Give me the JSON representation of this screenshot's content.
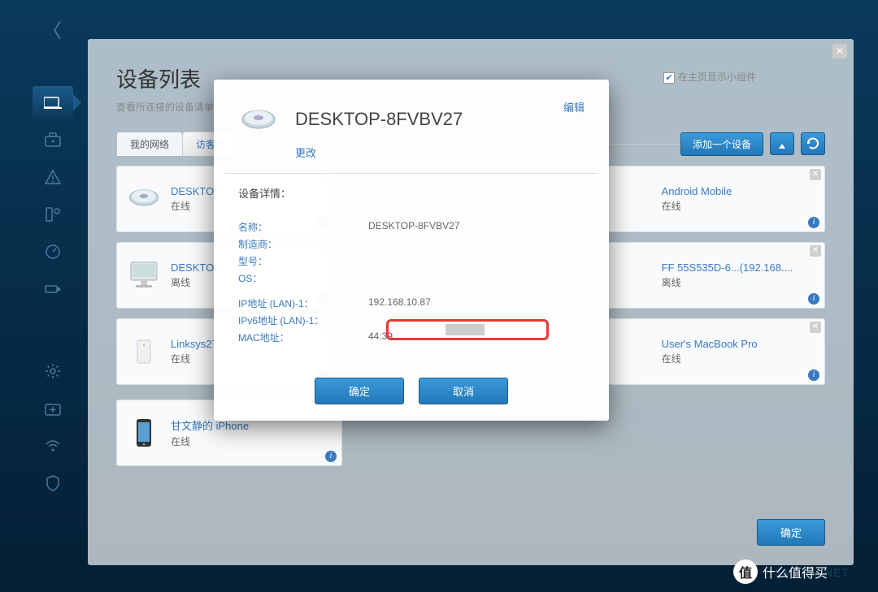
{
  "page": {
    "title": "设备列表",
    "subtitle": "查看所连接的设备清单以",
    "widget_checkbox_label": "在主页显示小组件"
  },
  "tabs": {
    "my_network": "我的网络",
    "guest_network": "访客网",
    "add_device": "添加一个设备"
  },
  "devices": [
    {
      "name": "DESKTOP",
      "status": "在线",
      "icon": "disk"
    },
    {
      "name": "Android Mobile",
      "status": "在线",
      "icon": "phone"
    },
    {
      "name": "DESKTOP",
      "status": "离线",
      "icon": "imac"
    },
    {
      "name": "FF 55S535D-6...(192.168....",
      "status": "离线",
      "icon": "phone"
    },
    {
      "name": "Linksys27",
      "status": "在线",
      "icon": "router"
    },
    {
      "name": "User's MacBook Pro",
      "status": "在线",
      "icon": "laptop"
    },
    {
      "name": "甘文静的 iPhone",
      "status": "在线",
      "icon": "phone"
    }
  ],
  "footer": {
    "ok": "确定"
  },
  "modal": {
    "title": "DESKTOP-8FVBV27",
    "edit": "编辑",
    "change": "更改",
    "section_title": "设备详情：",
    "labels": {
      "name": "名称：",
      "manufacturer": "制造商：",
      "model": "型号：",
      "os": "OS：",
      "ip": "IP地址 (LAN)-1：",
      "ipv6": "IPv6地址 (LAN)-1：",
      "mac": "MAC地址："
    },
    "values": {
      "name": "DESKTOP-8FVBV27",
      "ip": "192.168.10.87",
      "mac": "44:39."
    },
    "buttons": {
      "ok": "确定",
      "cancel": "取消"
    }
  },
  "watermark": {
    "badge": "值",
    "text": "什么值得买"
  }
}
